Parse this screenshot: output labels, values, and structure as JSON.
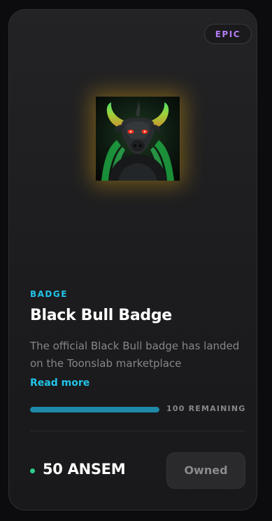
{
  "card": {
    "rarity": "EPIC",
    "category": "BADGE",
    "title": "Black Bull Badge",
    "description": "The official Black Bull badge has landed on the Toonslab marketplace",
    "read_more_label": "Read more",
    "remaining_label": "100 REMAINING",
    "remaining_fraction": 1.0,
    "price": "50 ANSEM",
    "action_label": "Owned",
    "artwork_icon": "black-bull-artwork"
  },
  "colors": {
    "accent_cyan": "#22c4e8",
    "rarity_epic": "#b57cf5",
    "price_dot": "#2ecf8a",
    "progress_fill": "#1e8aa8"
  }
}
